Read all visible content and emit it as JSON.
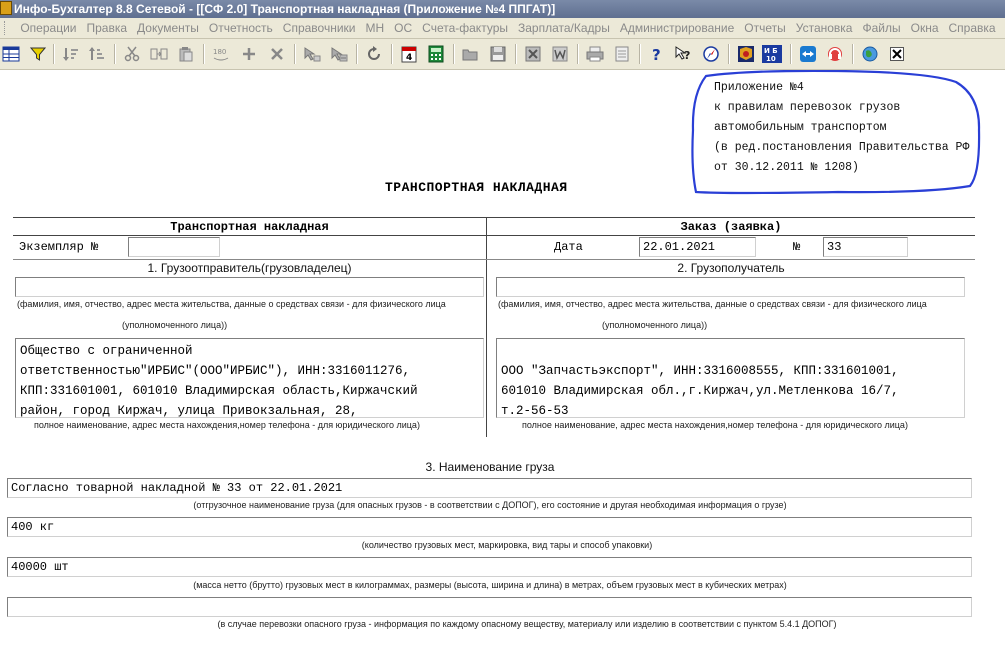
{
  "window": {
    "title": "Инфо-Бухгалтер 8.8 Сетевой - [[СФ 2.0] Транспортная накладная (Приложение №4 ППГАТ)]"
  },
  "menu": [
    "Операции",
    "Правка",
    "Документы",
    "Отчетность",
    "Справочники",
    "МН",
    "ОС",
    "Счета-фактуры",
    "Зарплата/Кадры",
    "Администрирование",
    "Отчеты",
    "Установка",
    "Файлы",
    "Окна",
    "Справка"
  ],
  "toolbar": {
    "calendar_day": "4",
    "ib10_label": "ИБ 10"
  },
  "annex": {
    "lines": [
      "Приложение №4",
      "к правилам перевозок грузов",
      "автомобильным транспортом",
      "(в ред.постановления Правительства РФ",
      "от 30.12.2011 № 1208)"
    ]
  },
  "form": {
    "title": "ТРАНСПОРТНАЯ НАКЛАДНАЯ",
    "left_header": "Транспортная накладная",
    "right_header": "Заказ (заявка)",
    "copy_label": "Экземпляр №",
    "copy_value": "",
    "date_label": "Дата",
    "date_value": "22.01.2021",
    "number_label": "№",
    "number_value": "33",
    "sender": {
      "title": "1. Грузоотправитель(грузовладелец)",
      "person_value": "",
      "person_hint": "(фамилия, имя, отчество, адрес места жительства, данные о средствах связи -  для физического лица",
      "person_hint2": "(уполномоченного лица))",
      "org_text": "Общество с ограниченной\nответственностью\"ИРБИС\"(ООО\"ИРБИС\"), ИНН:3316011276,\nКПП:331601001, 601010 Владимирская область,Киржачский\nрайон, город Киржач, улица Привокзальная, 28,",
      "org_hint": "полное наименование, адрес места нахождения,номер телефона - для юридического лица)"
    },
    "receiver": {
      "title": "2. Грузополучатель",
      "person_value": "",
      "person_hint": "(фамилия, имя, отчество, адрес места жительства, данные о средствах связи -  для физического лица",
      "person_hint2": "(уполномоченного лица))",
      "org_text": "\nООО \"Запчастьэкспорт\", ИНН:3316008555, КПП:331601001,\n601010 Владимирская обл.,г.Киржач,ул.Метленкова 16/7,\nт.2-56-53",
      "org_hint": "полное наименование, адрес места нахождения,номер телефона - для юридического лица)"
    },
    "cargo": {
      "title": "3. Наименование груза",
      "name_value": "Согласно товарной накладной № 33 от 22.01.2021",
      "name_hint": "(отгрузочное наименование груза (для опасных грузов - в соответствии с ДОПОГ), его состояние и другая необходимая информация о грузе)",
      "places_value": "400 кг",
      "places_hint": "(количество грузовых мест, маркировка, вид тары и способ упаковки)",
      "mass_value": "40000 шт",
      "mass_hint": "(масса нетто (брутто) грузовых мест в килограммах, размеры (высота, ширина и длина) в метрах, объем грузовых мест в кубических метрах)",
      "danger_value": "",
      "danger_hint": "(в случае перевозки опасного груза - информация по каждому опасному веществу, материалу или изделию в соответствии с пунктом 5.4.1 ДОПОГ)"
    }
  },
  "colors": {
    "annotation": "#2a3fd6",
    "titlebar": "#6a7a9a",
    "chrome": "#ece9d8"
  }
}
